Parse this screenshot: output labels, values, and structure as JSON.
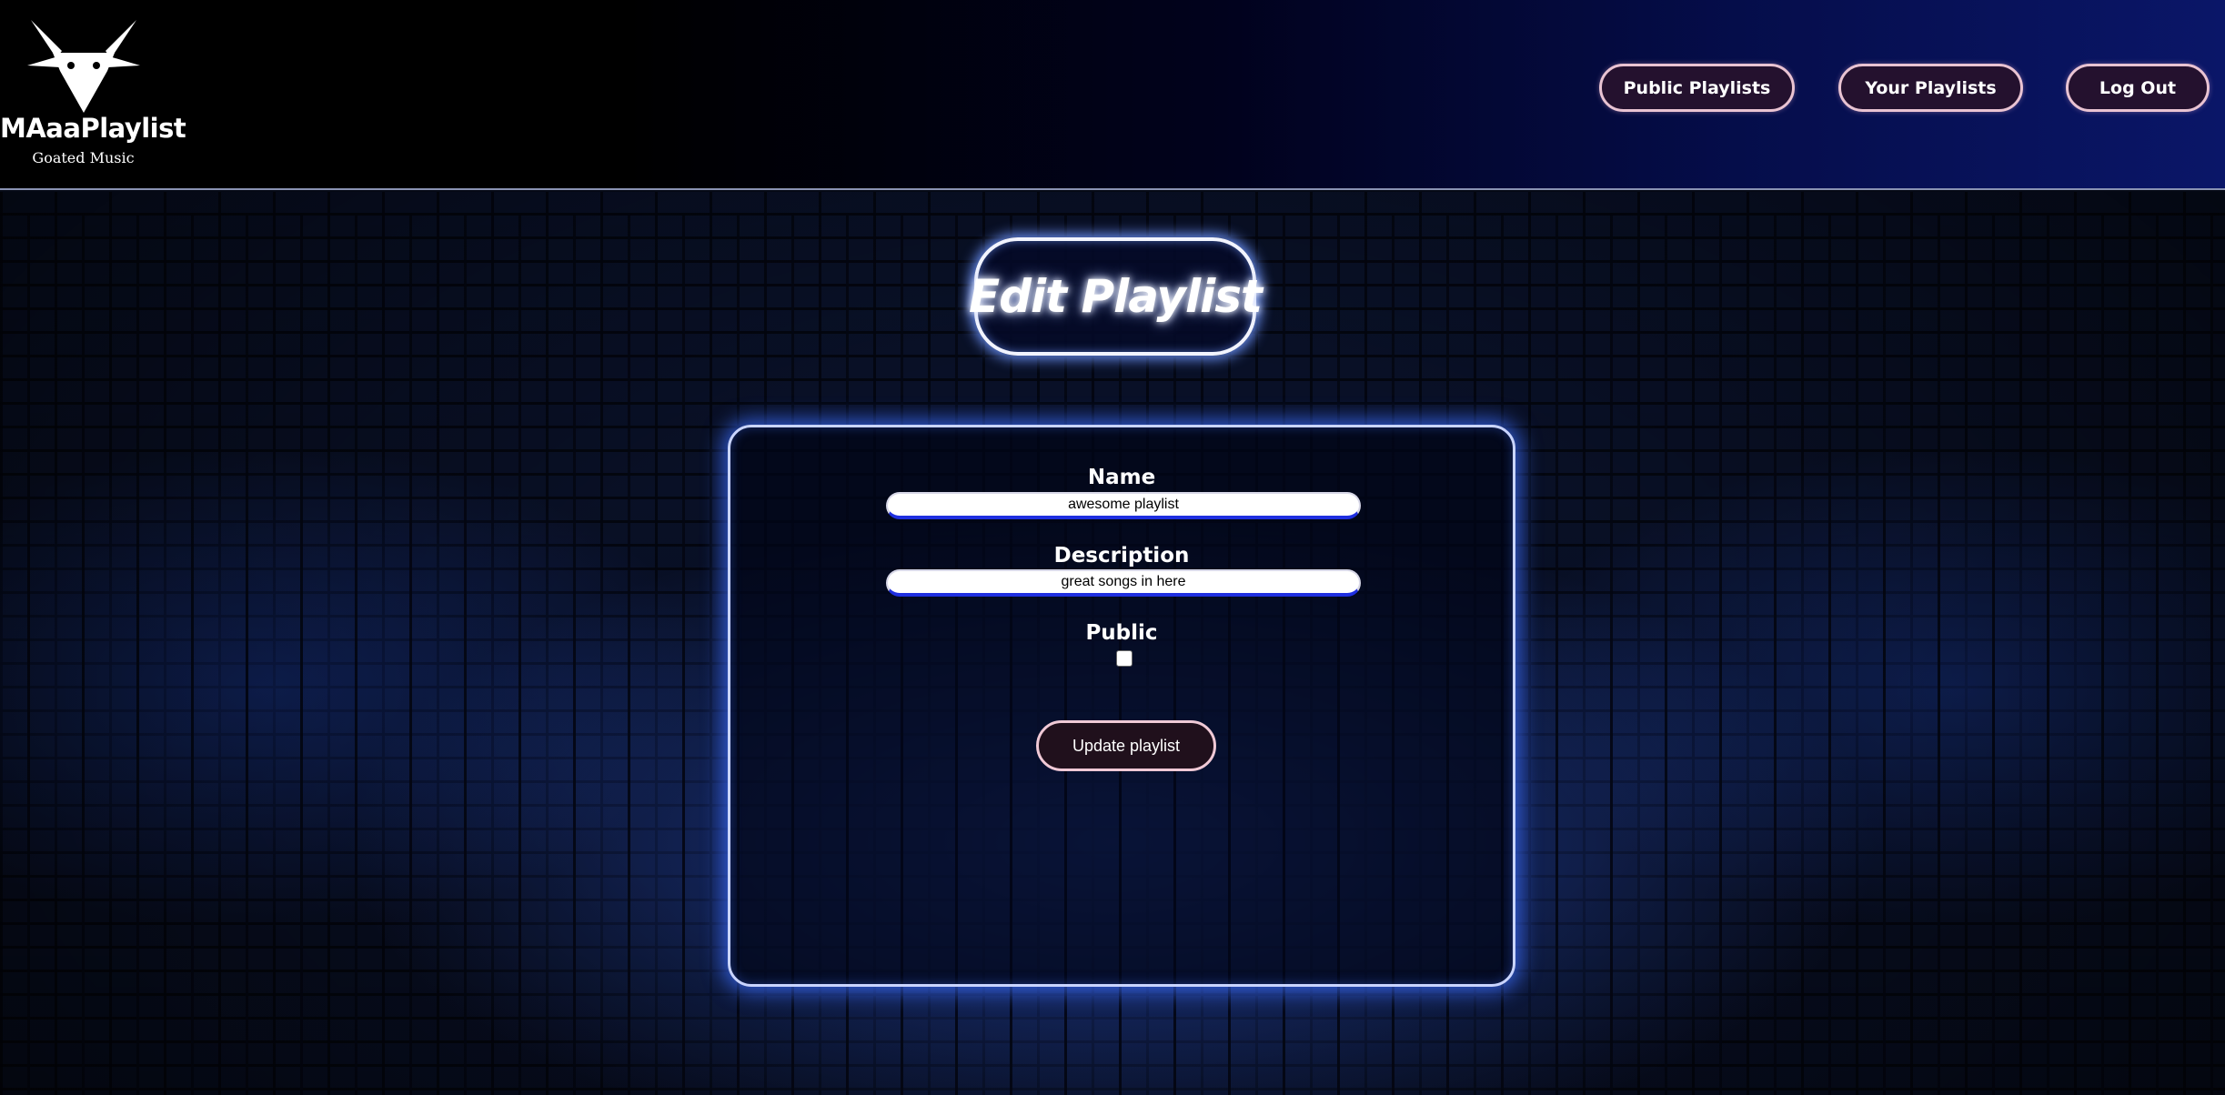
{
  "app": {
    "name": "MAaaPlaylist",
    "tagline": "Goated Music",
    "logo_icon": "goat-head-icon"
  },
  "nav": {
    "public_playlists": "Public Playlists",
    "your_playlists": "Your Playlists",
    "log_out": "Log Out"
  },
  "page": {
    "title": "Edit Playlist"
  },
  "form": {
    "name_label": "Name",
    "name_value": "awesome playlist",
    "description_label": "Description",
    "description_value": "great songs in here",
    "public_label": "Public",
    "public_checked": false,
    "submit_label": "Update playlist"
  },
  "colors": {
    "header_gradient_end": "#0a1668",
    "neon_glow": "#4c7bff",
    "button_border": "#e9c3d2",
    "input_underline": "#1f2fe0"
  }
}
